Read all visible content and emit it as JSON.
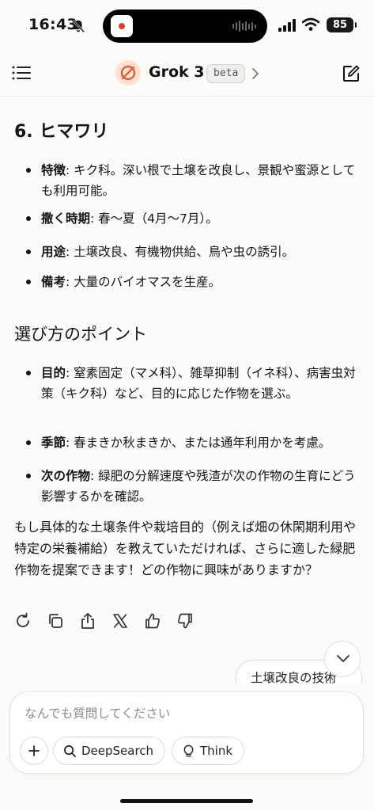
{
  "status": {
    "time": "16:43",
    "battery": "85"
  },
  "header": {
    "title": "Grok 3",
    "badge": "beta"
  },
  "sections": [
    {
      "heading": "6. ヒマワリ"
    },
    {
      "heading": "選び方のポイント"
    }
  ],
  "sunflower": {
    "items": [
      {
        "label": "特徴",
        "text": ": キク科。深い根で土壌を改良し、景観や蜜源としても利用可能。"
      },
      {
        "label": "撒く時期",
        "text": ": 春〜夏（4月〜7月）。"
      },
      {
        "label": "用途",
        "text": ": 土壌改良、有機物供給、鳥や虫の誘引。"
      },
      {
        "label": "備考",
        "text": ": 大量のバイオマスを生産。"
      }
    ]
  },
  "points": {
    "items": [
      {
        "label": "目的",
        "text": ": 窒素固定（マメ科）、雑草抑制（イネ科）、病害虫対策（キク科）など、目的に応じた作物を選ぶ。"
      },
      {
        "label": "季節",
        "text": ": 春まきか秋まきか、または通年利用かを考慮。"
      },
      {
        "label": "次の作物",
        "text": ": 緑肥の分解速度や残渣が次の作物の生育にどう影響するかを確認。"
      }
    ]
  },
  "closing": "もし具体的な土壌条件や栽培目的（例えば畑の休閑期利用や特定の栄養補給）を教えていただければ、さらに適した緑肥作物を提案できます！どの作物に興味がありますか？",
  "suggestion": "土壌改良の技術",
  "composer": {
    "placeholder": "なんでも質問してください",
    "deepsearch": "DeepSearch",
    "think": "Think"
  },
  "icons": [
    "menu-icon",
    "bell-off-icon",
    "compose-icon",
    "regenerate-icon",
    "copy-icon",
    "share-icon",
    "x-icon",
    "thumbs-up-icon",
    "thumbs-down-icon",
    "chevron-down-icon",
    "plus-icon",
    "search-icon",
    "lightbulb-icon"
  ]
}
